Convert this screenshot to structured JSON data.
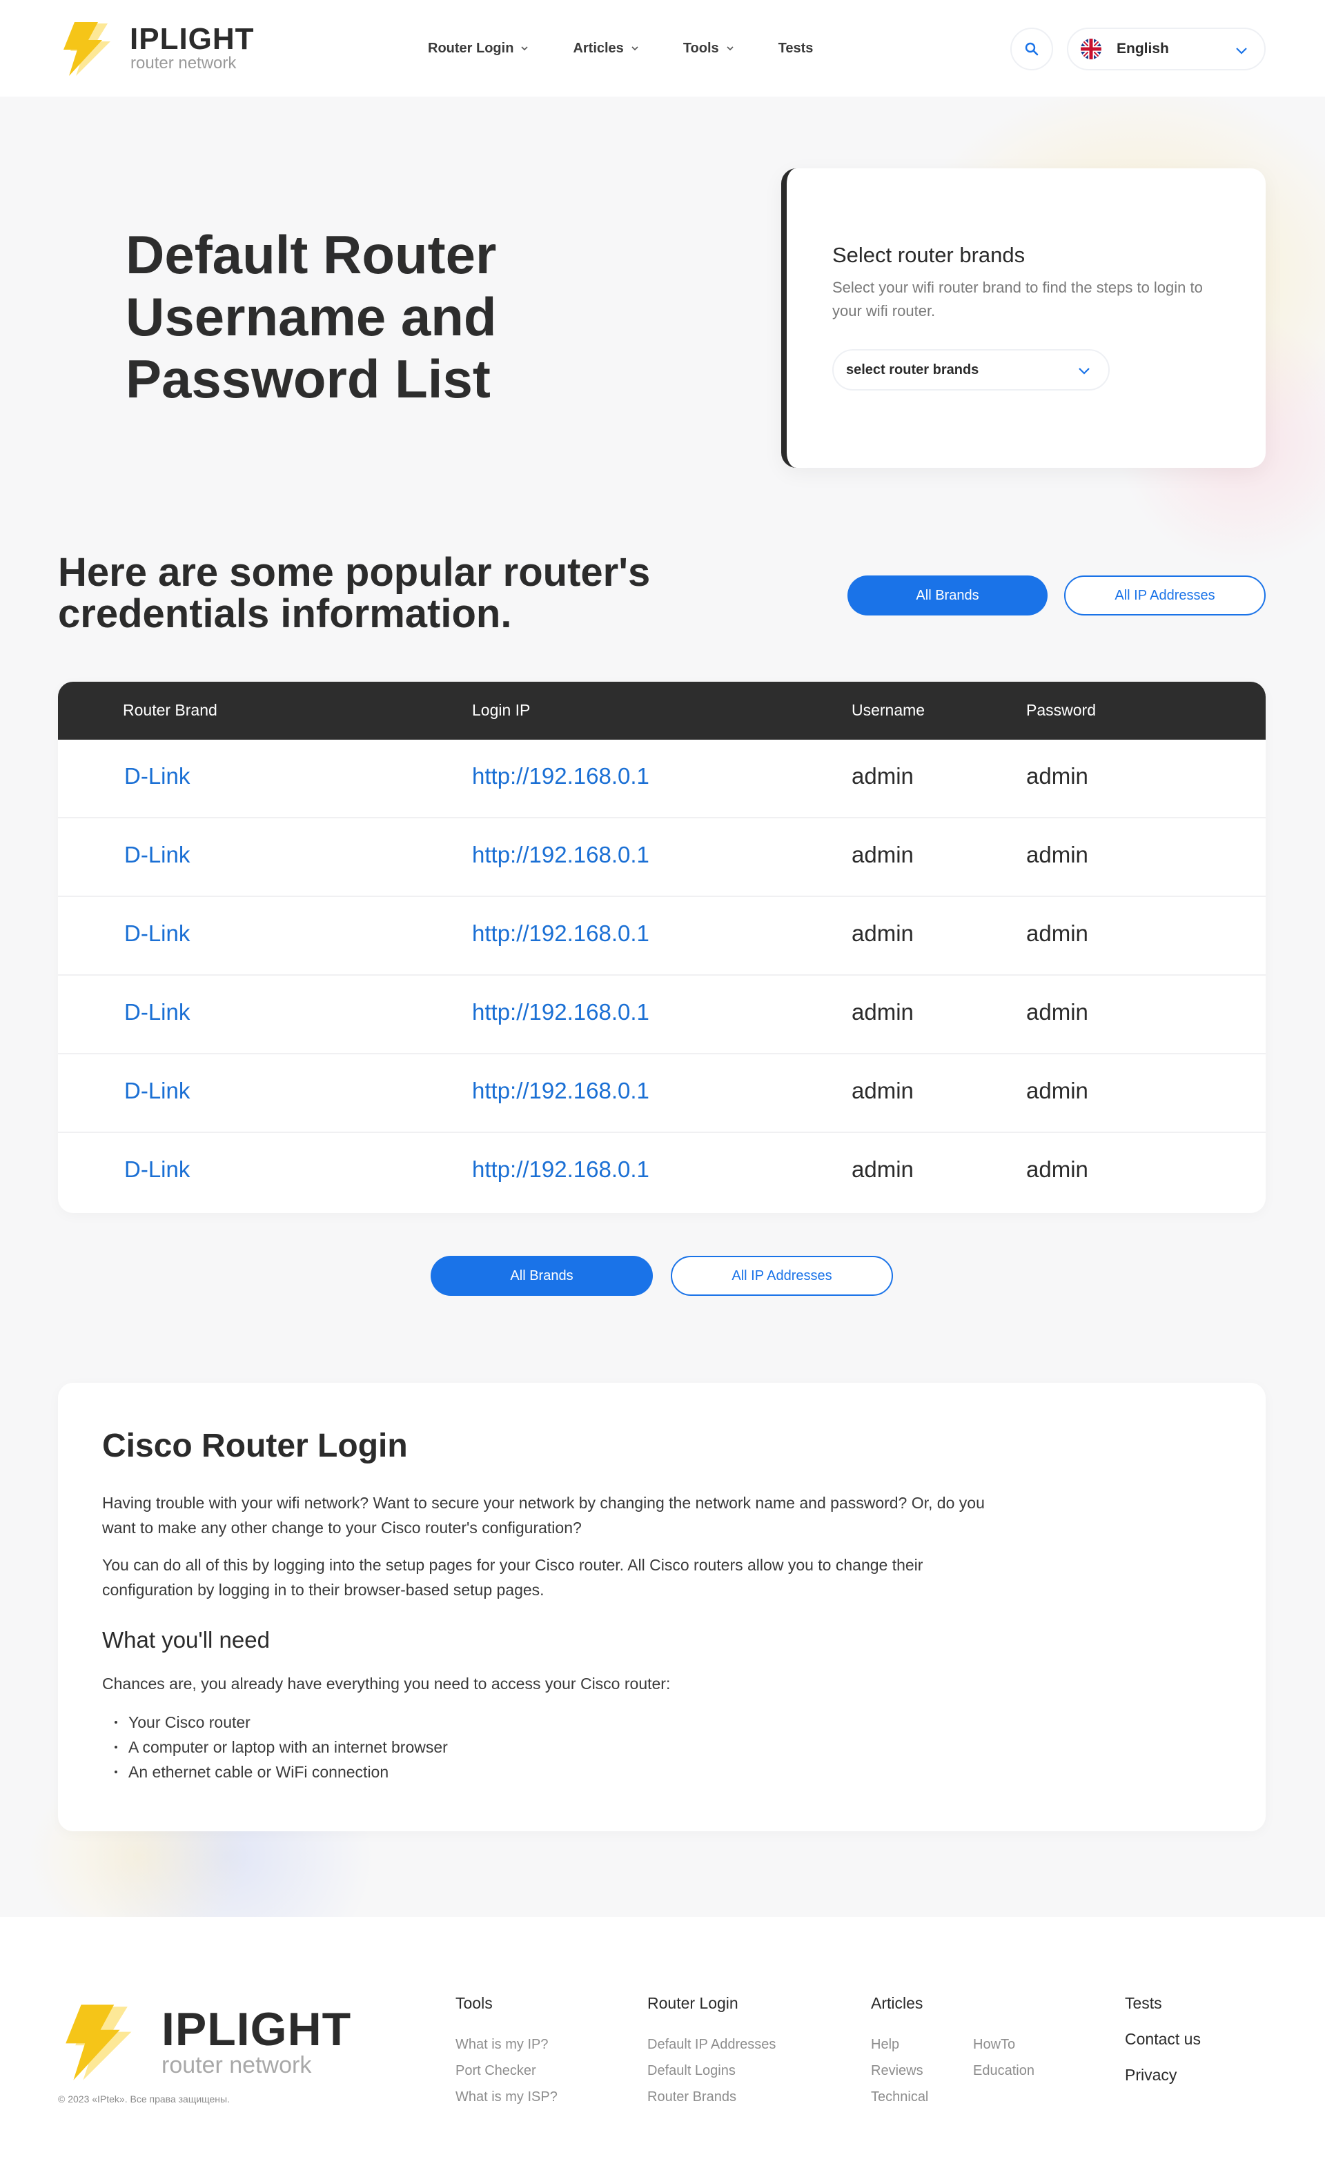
{
  "header": {
    "logo_title": "IPLIGHT",
    "logo_sub": "router network",
    "nav": [
      {
        "label": "Router Login",
        "has_dropdown": true
      },
      {
        "label": "Articles",
        "has_dropdown": true
      },
      {
        "label": "Tools",
        "has_dropdown": true
      },
      {
        "label": "Tests",
        "has_dropdown": false
      }
    ],
    "language": "English"
  },
  "hero": {
    "title": "Default Router Username and Password List"
  },
  "select_card": {
    "title": "Select router brands",
    "description": "Select your wifi router brand to find the steps to login to your wifi router.",
    "select_placeholder": "select router brands"
  },
  "popular": {
    "title": "Here are some popular router's credentials information.",
    "all_brands_label": "All Brands",
    "all_ip_label": "All IP Addresses"
  },
  "table": {
    "headers": [
      "Router Brand",
      "Login IP",
      "Username",
      "Password"
    ],
    "rows": [
      {
        "brand": "D-Link",
        "ip": "http://192.168.0.1",
        "username": "admin",
        "password": "admin"
      },
      {
        "brand": "D-Link",
        "ip": "http://192.168.0.1",
        "username": "admin",
        "password": "admin"
      },
      {
        "brand": "D-Link",
        "ip": "http://192.168.0.1",
        "username": "admin",
        "password": "admin"
      },
      {
        "brand": "D-Link",
        "ip": "http://192.168.0.1",
        "username": "admin",
        "password": "admin"
      },
      {
        "brand": "D-Link",
        "ip": "http://192.168.0.1",
        "username": "admin",
        "password": "admin"
      },
      {
        "brand": "D-Link",
        "ip": "http://192.168.0.1",
        "username": "admin",
        "password": "admin"
      }
    ]
  },
  "bottom_buttons": {
    "all_brands_label": "All Brands",
    "all_ip_label": "All IP Addresses"
  },
  "article": {
    "title": "Cisco Router Login",
    "para1": "Having trouble with your wifi network? Want to secure your network by changing the network name and password? Or, do you want to make any other change to your Cisco router's configuration?",
    "para2": "You can do all of this by logging into the setup pages for your Cisco router. All Cisco routers allow you to change their configuration by logging in to their browser-based setup pages.",
    "subtitle": "What you'll need",
    "para3": "Chances are, you already have everything you need to access your Cisco router:",
    "list": [
      "Your Cisco router",
      "A computer or laptop with an internet browser",
      "An ethernet cable or WiFi connection"
    ]
  },
  "footer": {
    "logo_title": "IPLIGHT",
    "logo_sub": "router network",
    "copyright": "© 2023 «IPtek». Все права защищены.",
    "tools": {
      "title": "Tools",
      "links": [
        "What is my IP?",
        "Port Checker",
        "What is my ISP?"
      ]
    },
    "router_login": {
      "title": "Router Login",
      "links": [
        "Default IP Addresses",
        "Default Logins",
        "Router Brands"
      ]
    },
    "articles": {
      "title": "Articles",
      "links_col1": [
        "Help",
        "Reviews",
        "Technical"
      ],
      "links_col2": [
        "HowTo",
        "Education"
      ]
    },
    "misc": [
      "Tests",
      "Contact us",
      "Privacy"
    ]
  },
  "colors": {
    "accent": "#1a73e8",
    "dark": "#2d2d2d",
    "logo_yellow": "#f5c518"
  }
}
